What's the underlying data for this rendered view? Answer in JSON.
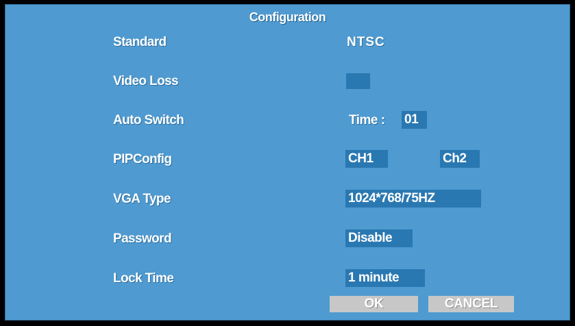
{
  "dialog": {
    "title": "Configuration",
    "rows": {
      "standard": {
        "label": "Standard",
        "value": "NTSC"
      },
      "video_loss": {
        "label": "Video Loss"
      },
      "auto_switch": {
        "label": "Auto Switch",
        "prefix": "Time :",
        "value": "01"
      },
      "pip_config": {
        "label": "PIPConfig",
        "value1": "CH1",
        "value2": "Ch2"
      },
      "vga_type": {
        "label": "VGA Type",
        "value": "1024*768/75HZ"
      },
      "password": {
        "label": "Password",
        "value": "Disable"
      },
      "lock_time": {
        "label": "Lock Time",
        "value": "1 minute"
      }
    },
    "buttons": {
      "ok": "OK",
      "cancel": "CANCEL"
    }
  },
  "colors": {
    "panel": "#4f9ad0",
    "field": "#2a78b2",
    "button": "#c7c7c7"
  }
}
